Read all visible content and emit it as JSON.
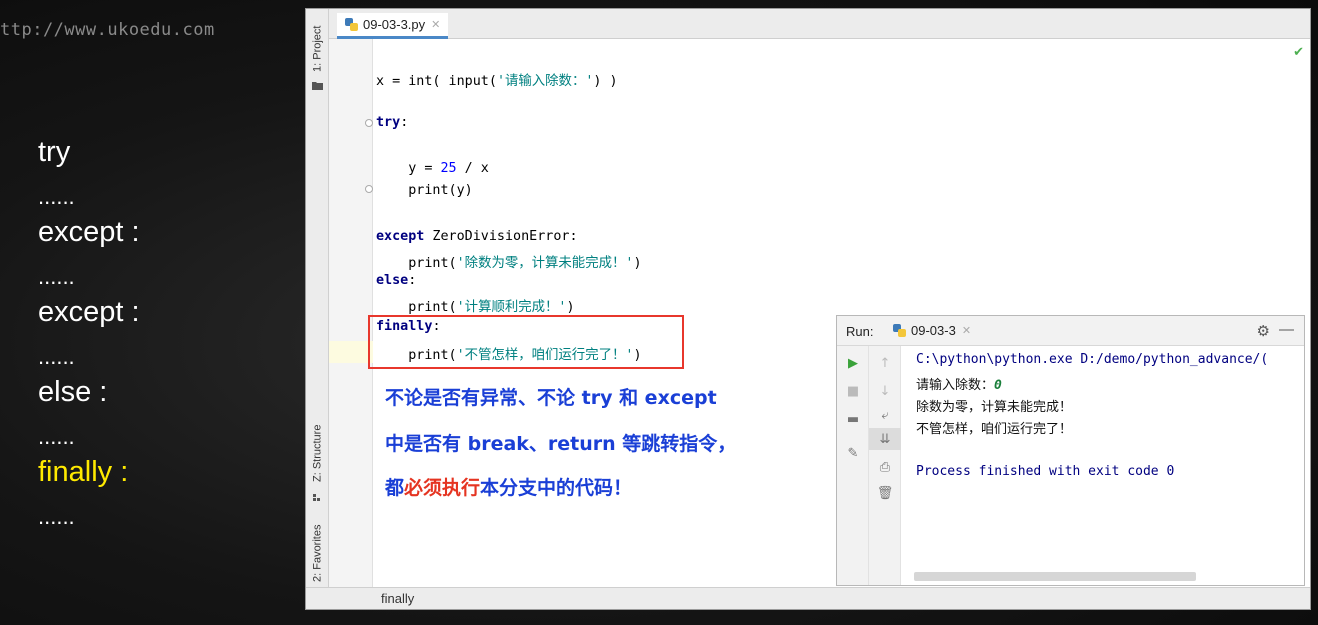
{
  "watermark": "ttp://www.ukoedu.com",
  "slide": {
    "lines": [
      "try",
      "except :",
      "except :",
      "else :",
      "finally :"
    ],
    "dots": "......"
  },
  "ide": {
    "file_tab": "09-03-3.py",
    "tool_tabs": {
      "project": "1: Project",
      "structure": "Z: Structure",
      "favorites": "2: Favorites"
    },
    "code": {
      "l1_kw": "x = ",
      "l1_fn": "int( input(",
      "l1_str": "'请输入除数：'",
      "l1_end": ") )",
      "l2": "try",
      "l3_a": "    y = ",
      "l3_num": "25",
      "l3_b": " / x",
      "l4": "    print(y)",
      "l5_kw": "except",
      "l5_rest": " ZeroDivisionError:",
      "l6_a": "    print(",
      "l6_str": "'除数为零，计算未能完成！'",
      "l6_b": ")",
      "l7": "else",
      "l8_a": "    print(",
      "l8_str": "'计算顺利完成！'",
      "l8_b": ")",
      "l9": "finally",
      "l10_a": "    print(",
      "l10_str": "'不管怎样，咱们运行完了！'",
      "l10_b": ")",
      "colon": ":"
    },
    "annotation": {
      "line1": "不论是否有异常、不论 try 和 except",
      "line2": "中是否有 break、return 等跳转指令，",
      "line3_pre": "都",
      "line3_red": "必须执行",
      "line3_post": "本分支中的代码！"
    },
    "breadcrumb": "finally"
  },
  "run": {
    "label": "Run:",
    "tab": "09-03-3",
    "console": {
      "cmd": "C:\\python\\python.exe D:/demo/python_advance/(",
      "prompt": "请输入除数：",
      "input_value": "0",
      "out1": "除数为零，计算未能完成！",
      "out2": "不管怎样，咱们运行完了！",
      "exit": "Process finished with exit code 0"
    }
  },
  "colors": {
    "keyword": "#000080",
    "string": "#008080",
    "number": "#0000ff",
    "annotation_blue": "#1a3fd6",
    "annotation_red": "#e53421",
    "highlight_box": "#e8372c",
    "slide_highlight": "#ffea00"
  }
}
